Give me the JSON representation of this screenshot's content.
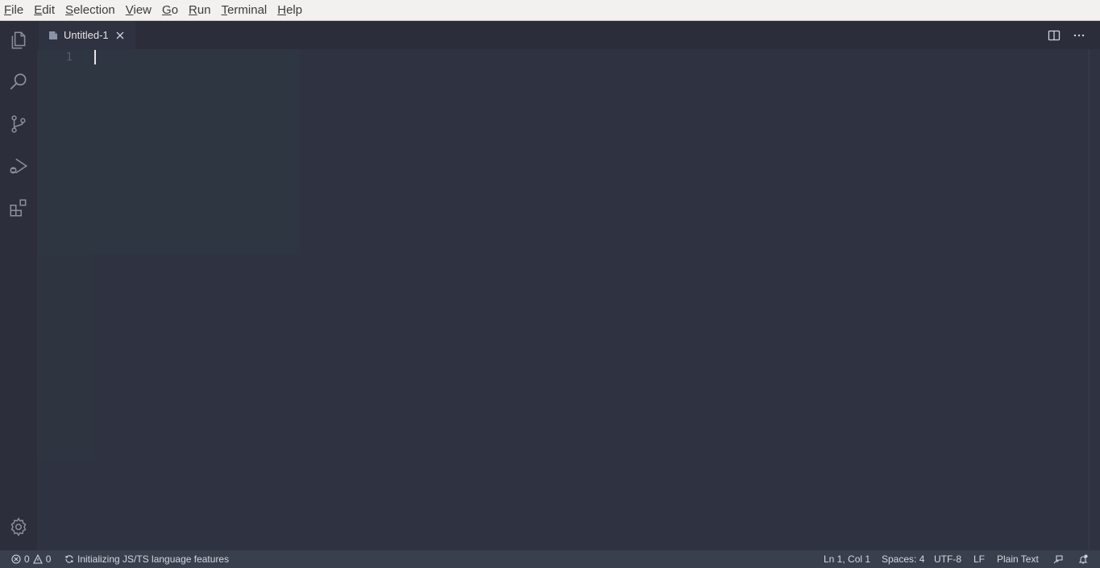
{
  "menubar": {
    "items": [
      {
        "mnemonic": "F",
        "rest": "ile"
      },
      {
        "mnemonic": "E",
        "rest": "dit"
      },
      {
        "mnemonic": "S",
        "rest": "election"
      },
      {
        "mnemonic": "V",
        "rest": "iew"
      },
      {
        "mnemonic": "G",
        "rest": "o"
      },
      {
        "mnemonic": "R",
        "rest": "un"
      },
      {
        "mnemonic": "T",
        "rest": "erminal"
      },
      {
        "mnemonic": "H",
        "rest": "elp"
      }
    ]
  },
  "activitybar": {
    "icons": [
      "explorer-icon",
      "search-icon",
      "source-control-icon",
      "run-debug-icon",
      "extensions-icon"
    ],
    "bottom_icon": "gear-icon"
  },
  "tabs": [
    {
      "label": "Untitled-1",
      "icon": "untitled-file-icon"
    }
  ],
  "tab_actions": [
    "split-editor-icon",
    "more-actions-icon"
  ],
  "editor": {
    "line_numbers": [
      "1"
    ],
    "content": ""
  },
  "statusbar": {
    "errors": "0",
    "warnings": "0",
    "activity": "Initializing JS/TS language features",
    "position": "Ln 1, Col 1",
    "indent": "Spaces: 4",
    "encoding": "UTF-8",
    "eol": "LF",
    "language": "Plain Text"
  },
  "colors": {
    "editor_bg": "#2f3240",
    "activitybar_bg": "#2c2f3b",
    "statusbar_bg": "#3a3f4e",
    "menubar_bg": "#f2f1f0"
  }
}
